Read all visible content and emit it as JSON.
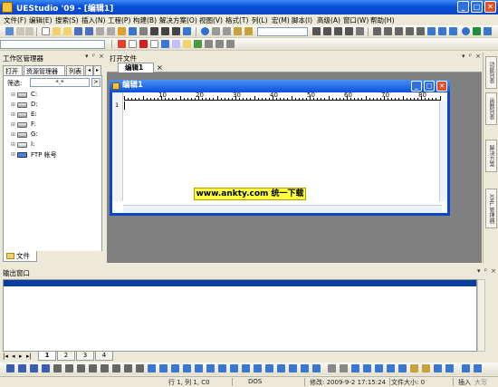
{
  "window": {
    "title": "UEStudio '09 - [编辑1]",
    "min": "_",
    "max": "□",
    "close": "✕"
  },
  "menu": [
    "文件(F)",
    "编辑(E)",
    "搜索(S)",
    "插入(N)",
    "工程(P)",
    "构建(B)",
    "解决方案(O)",
    "视图(V)",
    "格式(T)",
    "列(L)",
    "宏(M)",
    "脚本(I)",
    "高级(A)",
    "窗口(W)",
    "帮助(H)"
  ],
  "workspace": {
    "title": "工作区管理器",
    "tabs": [
      "打开",
      "资源管理器",
      "列表"
    ],
    "filter_label": "筛选:",
    "filter_value": "*.*",
    "drives": [
      "C:",
      "D:",
      "E:",
      "F:",
      "G:",
      "I:",
      "FTP 帐号"
    ],
    "bottom_tab": "文件"
  },
  "documents": {
    "header": "打开文件",
    "tab": "编辑1",
    "tab_close": "×",
    "window_title": "编辑1",
    "ruler": [
      "10",
      "20",
      "30",
      "40",
      "50",
      "60",
      "70",
      "80"
    ],
    "line_number": "1"
  },
  "watermark": "www.ankty.com 统一下载",
  "right_tabs": [
    "功能列表",
    "函数列表",
    "解决方案",
    "XML 管理器"
  ],
  "output": {
    "title": "输出窗口"
  },
  "sheet_tabs": [
    "1",
    "2",
    "3",
    "4"
  ],
  "status": {
    "position": "行 1, 列 1, C0",
    "format": "DOS",
    "modified": "修改: 2009-9-2 17:15:24",
    "filesize": "文件大小: 0",
    "mode": "插入",
    "case": "大写"
  },
  "colors": {
    "titlebar": "#0a4fd8",
    "output_bar": "#0a3d9e",
    "watermark_bg": "#ffff40"
  }
}
